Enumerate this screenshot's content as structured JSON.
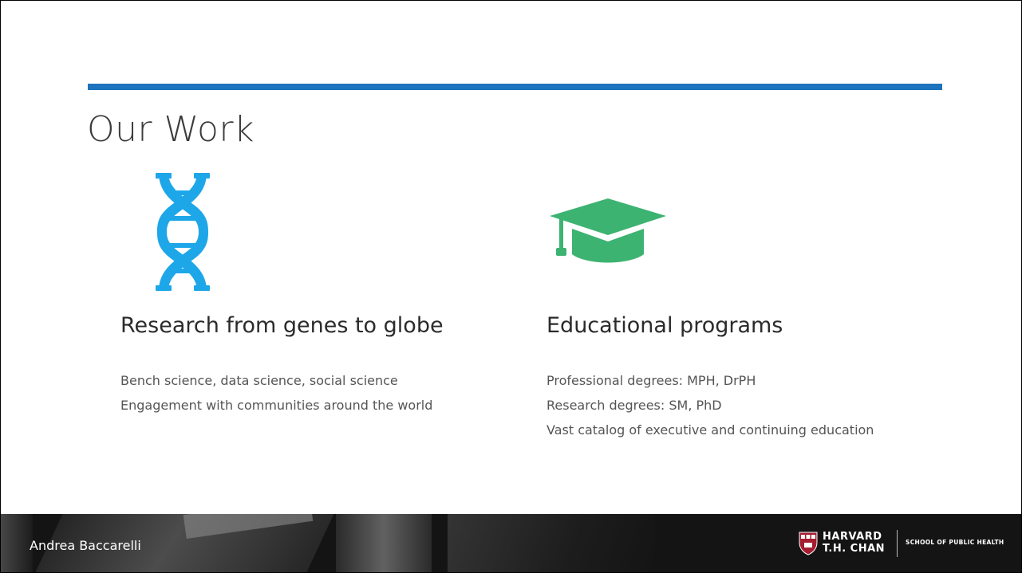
{
  "slide": {
    "title": "Our Work",
    "accent_color": "#1e73be"
  },
  "left_column": {
    "icon": "dna-icon",
    "icon_color": "#1ea7e8",
    "heading": "Research from genes to globe",
    "bullets": [
      "Bench science, data science, social science",
      "Engagement with communities around the world"
    ]
  },
  "right_column": {
    "icon": "graduation-cap-icon",
    "icon_color": "#3cb371",
    "heading": "Educational programs",
    "bullets": [
      "Professional degrees: MPH, DrPH",
      "Research degrees: SM, PhD",
      "Vast catalog of executive and continuing education"
    ]
  },
  "footer": {
    "presenter": "Andrea Baccarelli",
    "logo_line1": "HARVARD",
    "logo_line2": "T.H. CHAN",
    "logo_sub": "SCHOOL OF PUBLIC HEALTH",
    "shield_color": "#a51c30"
  }
}
